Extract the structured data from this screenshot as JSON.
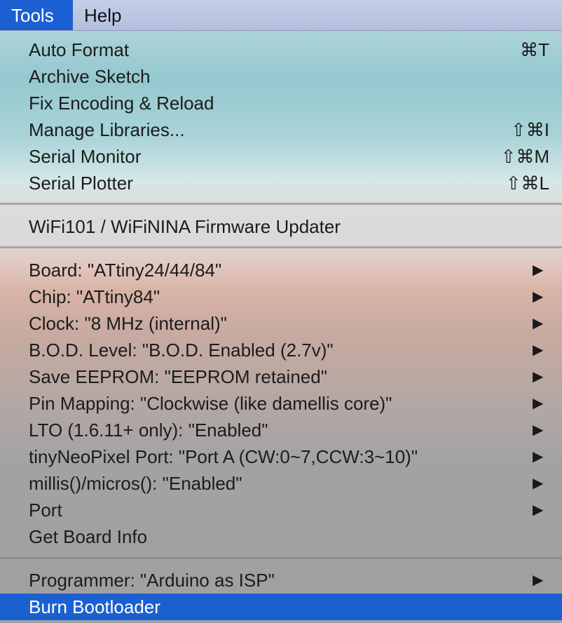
{
  "menubar": {
    "tools": "Tools",
    "help": "Help"
  },
  "menu": {
    "group1": [
      {
        "label": "Auto Format",
        "shortcut": "⌘T"
      },
      {
        "label": "Archive Sketch",
        "shortcut": ""
      },
      {
        "label": "Fix Encoding & Reload",
        "shortcut": ""
      },
      {
        "label": "Manage Libraries...",
        "shortcut": "⇧⌘I"
      },
      {
        "label": "Serial Monitor",
        "shortcut": "⇧⌘M"
      },
      {
        "label": "Serial Plotter",
        "shortcut": "⇧⌘L"
      }
    ],
    "group2": [
      {
        "label": "WiFi101 / WiFiNINA Firmware Updater"
      }
    ],
    "group3": [
      {
        "label": "Board: \"ATtiny24/44/84\"",
        "submenu": true
      },
      {
        "label": "Chip: \"ATtiny84\"",
        "submenu": true
      },
      {
        "label": "Clock: \"8 MHz (internal)\"",
        "submenu": true
      },
      {
        "label": "B.O.D. Level: \"B.O.D. Enabled (2.7v)\"",
        "submenu": true
      },
      {
        "label": "Save EEPROM: \"EEPROM retained\"",
        "submenu": true
      },
      {
        "label": "Pin Mapping: \"Clockwise (like damellis core)\"",
        "submenu": true
      },
      {
        "label": "LTO (1.6.11+ only): \"Enabled\"",
        "submenu": true
      },
      {
        "label": "tinyNeoPixel Port: \"Port A (CW:0~7,CCW:3~10)\"",
        "submenu": true
      },
      {
        "label": "millis()/micros(): \"Enabled\"",
        "submenu": true
      },
      {
        "label": "Port",
        "submenu": true
      },
      {
        "label": "Get Board Info",
        "submenu": false
      }
    ],
    "group4": [
      {
        "label": "Programmer: \"Arduino as ISP\"",
        "submenu": true
      },
      {
        "label": "Burn Bootloader",
        "submenu": false,
        "highlighted": true
      }
    ],
    "submenu_arrow": "▶"
  },
  "colors": {
    "menubar_active": "#1b5fd3",
    "highlight": "#1b60d0"
  }
}
